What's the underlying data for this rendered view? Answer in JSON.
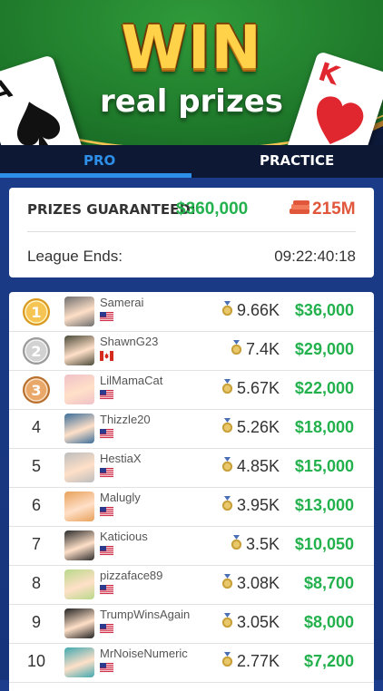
{
  "header": {
    "win_text": "WIN",
    "subtitle": "real prizes",
    "card_left_rank": "A",
    "card_right_rank": "K"
  },
  "tabs": [
    {
      "label": "PRO",
      "active": true
    },
    {
      "label": "PRACTICE",
      "active": false
    }
  ],
  "info": {
    "prizes_label": "PRIZES GUARANTEED:",
    "prizes_amount": "$360,000",
    "chips_amount": "215M",
    "league_label": "League Ends:",
    "league_timer": "09:22:40:18"
  },
  "colors": {
    "accent_blue": "#2d8fe8",
    "prize_green": "#23b14d",
    "chips_red": "#e0573c",
    "gold": "#ffd24a"
  },
  "leaderboard": [
    {
      "rank": "1",
      "medal": "gold-medal-icon",
      "name": "Samerai",
      "flag": "us-flag-icon",
      "score": "9.66K",
      "prize": "$36,000"
    },
    {
      "rank": "2",
      "medal": "silver-medal-icon",
      "name": "ShawnG23",
      "flag": "ca-flag-icon",
      "score": "7.4K",
      "prize": "$29,000"
    },
    {
      "rank": "3",
      "medal": "bronze-medal-icon",
      "name": "LilMamaCat",
      "flag": "us-flag-icon",
      "score": "5.67K",
      "prize": "$22,000"
    },
    {
      "rank": "4",
      "medal": "",
      "name": "Thizzle20",
      "flag": "us-flag-icon",
      "score": "5.26K",
      "prize": "$18,000"
    },
    {
      "rank": "5",
      "medal": "",
      "name": "HestiaX",
      "flag": "us-flag-icon",
      "score": "4.85K",
      "prize": "$15,000"
    },
    {
      "rank": "6",
      "medal": "",
      "name": "Malugly",
      "flag": "us-flag-icon",
      "score": "3.95K",
      "prize": "$13,000"
    },
    {
      "rank": "7",
      "medal": "",
      "name": "Katicious",
      "flag": "us-flag-icon",
      "score": "3.5K",
      "prize": "$10,050"
    },
    {
      "rank": "8",
      "medal": "",
      "name": "pizzaface89",
      "flag": "us-flag-icon",
      "score": "3.08K",
      "prize": "$8,700"
    },
    {
      "rank": "9",
      "medal": "",
      "name": "TrumpWinsAgain",
      "flag": "us-flag-icon",
      "score": "3.05K",
      "prize": "$8,000"
    },
    {
      "rank": "10",
      "medal": "",
      "name": "MrNoiseNumeric",
      "flag": "us-flag-icon",
      "score": "2.77K",
      "prize": "$7,200"
    }
  ]
}
